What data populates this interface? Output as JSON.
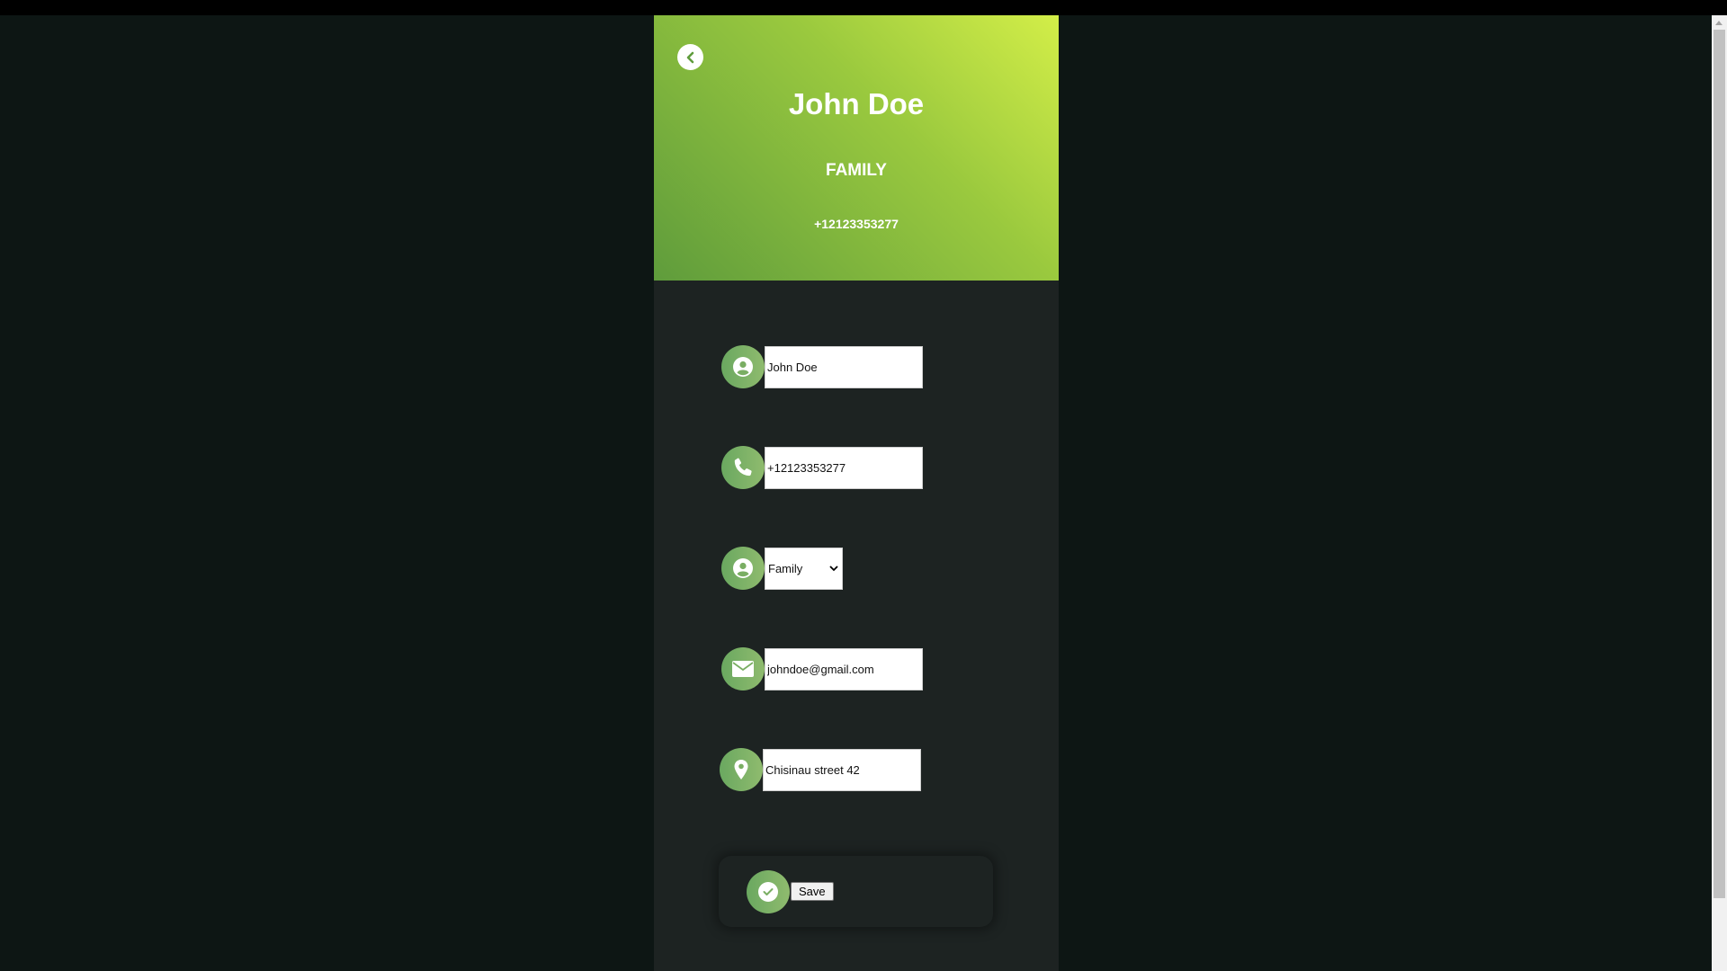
{
  "header": {
    "name": "John Doe",
    "group": "FAMILY",
    "phone": "+12123353277"
  },
  "fields": {
    "name_value": "John Doe",
    "phone_value": "+12123353277",
    "group_value": "Family",
    "email_value": "johndoe@gmail.com",
    "address_value": "Chisinau street 42"
  },
  "save": {
    "label": "Save"
  },
  "icons": {
    "back": "chevron-left-icon",
    "name": "user-icon",
    "phone": "phone-icon",
    "group": "user-icon",
    "email": "envelope-icon",
    "address": "map-pin-icon",
    "save": "check-icon"
  },
  "colors": {
    "page_background": "#0d1614",
    "card_background": "#1d2322",
    "gradient_start": "#d3ee48",
    "gradient_end": "#5f9c3c",
    "icon_green": "#6aa860"
  }
}
